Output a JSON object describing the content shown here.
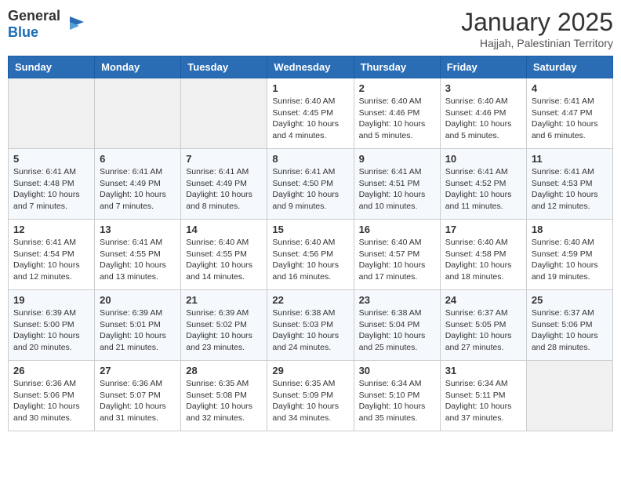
{
  "logo": {
    "general": "General",
    "blue": "Blue"
  },
  "header": {
    "month": "January 2025",
    "location": "Hajjah, Palestinian Territory"
  },
  "weekdays": [
    "Sunday",
    "Monday",
    "Tuesday",
    "Wednesday",
    "Thursday",
    "Friday",
    "Saturday"
  ],
  "weeks": [
    [
      {
        "day": "",
        "info": ""
      },
      {
        "day": "",
        "info": ""
      },
      {
        "day": "",
        "info": ""
      },
      {
        "day": "1",
        "info": "Sunrise: 6:40 AM\nSunset: 4:45 PM\nDaylight: 10 hours\nand 4 minutes."
      },
      {
        "day": "2",
        "info": "Sunrise: 6:40 AM\nSunset: 4:46 PM\nDaylight: 10 hours\nand 5 minutes."
      },
      {
        "day": "3",
        "info": "Sunrise: 6:40 AM\nSunset: 4:46 PM\nDaylight: 10 hours\nand 5 minutes."
      },
      {
        "day": "4",
        "info": "Sunrise: 6:41 AM\nSunset: 4:47 PM\nDaylight: 10 hours\nand 6 minutes."
      }
    ],
    [
      {
        "day": "5",
        "info": "Sunrise: 6:41 AM\nSunset: 4:48 PM\nDaylight: 10 hours\nand 7 minutes."
      },
      {
        "day": "6",
        "info": "Sunrise: 6:41 AM\nSunset: 4:49 PM\nDaylight: 10 hours\nand 7 minutes."
      },
      {
        "day": "7",
        "info": "Sunrise: 6:41 AM\nSunset: 4:49 PM\nDaylight: 10 hours\nand 8 minutes."
      },
      {
        "day": "8",
        "info": "Sunrise: 6:41 AM\nSunset: 4:50 PM\nDaylight: 10 hours\nand 9 minutes."
      },
      {
        "day": "9",
        "info": "Sunrise: 6:41 AM\nSunset: 4:51 PM\nDaylight: 10 hours\nand 10 minutes."
      },
      {
        "day": "10",
        "info": "Sunrise: 6:41 AM\nSunset: 4:52 PM\nDaylight: 10 hours\nand 11 minutes."
      },
      {
        "day": "11",
        "info": "Sunrise: 6:41 AM\nSunset: 4:53 PM\nDaylight: 10 hours\nand 12 minutes."
      }
    ],
    [
      {
        "day": "12",
        "info": "Sunrise: 6:41 AM\nSunset: 4:54 PM\nDaylight: 10 hours\nand 12 minutes."
      },
      {
        "day": "13",
        "info": "Sunrise: 6:41 AM\nSunset: 4:55 PM\nDaylight: 10 hours\nand 13 minutes."
      },
      {
        "day": "14",
        "info": "Sunrise: 6:40 AM\nSunset: 4:55 PM\nDaylight: 10 hours\nand 14 minutes."
      },
      {
        "day": "15",
        "info": "Sunrise: 6:40 AM\nSunset: 4:56 PM\nDaylight: 10 hours\nand 16 minutes."
      },
      {
        "day": "16",
        "info": "Sunrise: 6:40 AM\nSunset: 4:57 PM\nDaylight: 10 hours\nand 17 minutes."
      },
      {
        "day": "17",
        "info": "Sunrise: 6:40 AM\nSunset: 4:58 PM\nDaylight: 10 hours\nand 18 minutes."
      },
      {
        "day": "18",
        "info": "Sunrise: 6:40 AM\nSunset: 4:59 PM\nDaylight: 10 hours\nand 19 minutes."
      }
    ],
    [
      {
        "day": "19",
        "info": "Sunrise: 6:39 AM\nSunset: 5:00 PM\nDaylight: 10 hours\nand 20 minutes."
      },
      {
        "day": "20",
        "info": "Sunrise: 6:39 AM\nSunset: 5:01 PM\nDaylight: 10 hours\nand 21 minutes."
      },
      {
        "day": "21",
        "info": "Sunrise: 6:39 AM\nSunset: 5:02 PM\nDaylight: 10 hours\nand 23 minutes."
      },
      {
        "day": "22",
        "info": "Sunrise: 6:38 AM\nSunset: 5:03 PM\nDaylight: 10 hours\nand 24 minutes."
      },
      {
        "day": "23",
        "info": "Sunrise: 6:38 AM\nSunset: 5:04 PM\nDaylight: 10 hours\nand 25 minutes."
      },
      {
        "day": "24",
        "info": "Sunrise: 6:37 AM\nSunset: 5:05 PM\nDaylight: 10 hours\nand 27 minutes."
      },
      {
        "day": "25",
        "info": "Sunrise: 6:37 AM\nSunset: 5:06 PM\nDaylight: 10 hours\nand 28 minutes."
      }
    ],
    [
      {
        "day": "26",
        "info": "Sunrise: 6:36 AM\nSunset: 5:06 PM\nDaylight: 10 hours\nand 30 minutes."
      },
      {
        "day": "27",
        "info": "Sunrise: 6:36 AM\nSunset: 5:07 PM\nDaylight: 10 hours\nand 31 minutes."
      },
      {
        "day": "28",
        "info": "Sunrise: 6:35 AM\nSunset: 5:08 PM\nDaylight: 10 hours\nand 32 minutes."
      },
      {
        "day": "29",
        "info": "Sunrise: 6:35 AM\nSunset: 5:09 PM\nDaylight: 10 hours\nand 34 minutes."
      },
      {
        "day": "30",
        "info": "Sunrise: 6:34 AM\nSunset: 5:10 PM\nDaylight: 10 hours\nand 35 minutes."
      },
      {
        "day": "31",
        "info": "Sunrise: 6:34 AM\nSunset: 5:11 PM\nDaylight: 10 hours\nand 37 minutes."
      },
      {
        "day": "",
        "info": ""
      }
    ]
  ]
}
